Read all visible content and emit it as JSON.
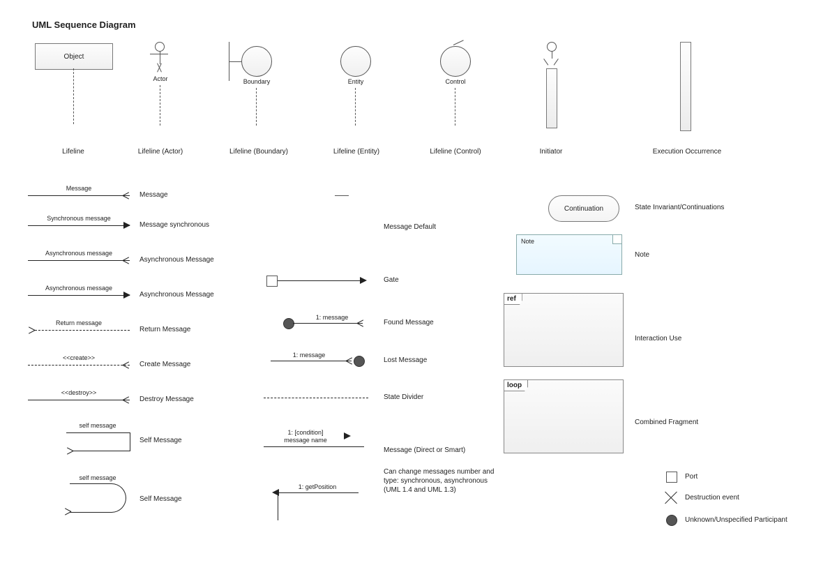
{
  "title": "UML Sequence Diagram",
  "row1": {
    "object_label": "Object",
    "lifeline": "Lifeline",
    "actor_name": "Actor",
    "actor_caption": "Lifeline (Actor)",
    "boundary_name": "Boundary",
    "boundary_caption": "Lifeline (Boundary)",
    "entity_name": "Entity",
    "entity_caption": "Lifeline (Entity)",
    "control_name": "Control",
    "control_caption": "Lifeline (Control)",
    "initiator_caption": "Initiator",
    "exec_caption": "Execution Occurrence"
  },
  "messages": {
    "msg_over": "Message",
    "msg_label": "Message",
    "sync_over": "Synchronous message",
    "sync_label": "Message synchronous",
    "async_over": "Asynchronous message",
    "async_label": "Asynchronous Message",
    "async2_over": "Asynchronous message",
    "async2_label": "Asynchronous Message",
    "return_over": "Return message",
    "return_label": "Return Message",
    "create_over": "<<create>>",
    "create_label": "Create Message",
    "destroy_over": "<<destroy>>",
    "destroy_label": "Destroy Message",
    "self_over": "self message",
    "self_label": "Self Message",
    "self2_over": "self message",
    "self2_label": "Self Message"
  },
  "middle": {
    "default_label": "Message Default",
    "gate_label": "Gate",
    "found_over": "1: message",
    "found_label": "Found Message",
    "lost_over": "1: message",
    "lost_label": "Lost Message",
    "divider_label": "State Divider",
    "direct_over1": "1: [condition]",
    "direct_over2": "message name",
    "direct_label": "Message (Direct or Smart)",
    "direct_note": "Can change messages number and type: synchronous, asynchronous (UML 1.4 and UML 1.3)",
    "getpos_over": "1: getPosition"
  },
  "right": {
    "continuation_label": "Continuation",
    "continuation_caption": "State Invariant/Continuations",
    "note_text": "Note",
    "note_caption": "Note",
    "ref_tag": "ref",
    "interaction_use": "Interaction Use",
    "loop_tag": "loop",
    "combined_fragment": "Combined Fragment",
    "port": "Port",
    "destruction": "Destruction event",
    "unknown": "Unknown/Unspecified Participant"
  }
}
